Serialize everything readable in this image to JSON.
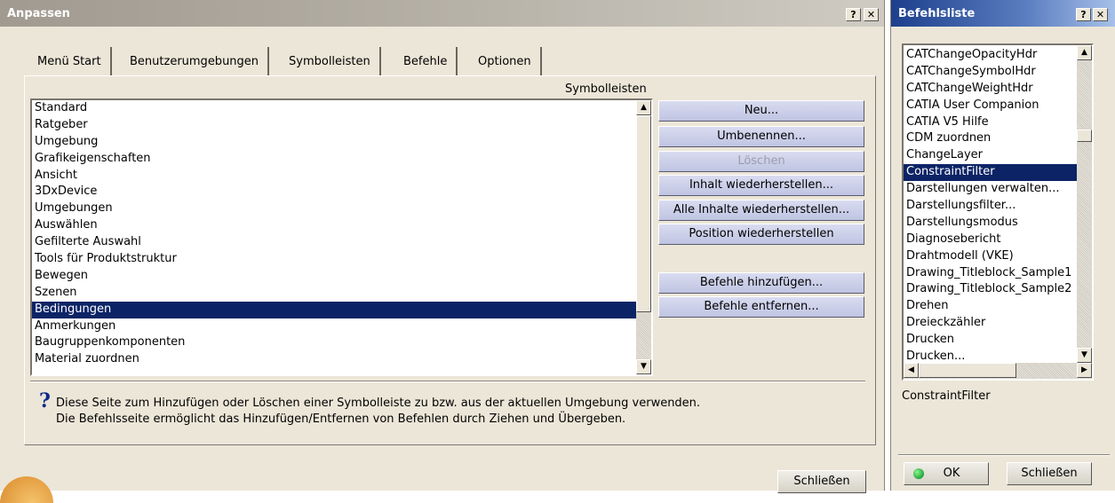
{
  "anpassen": {
    "title": "Anpassen",
    "help_btn": "?",
    "close_btn": "✕",
    "tabs": [
      "Menü Start",
      "Benutzerumgebungen",
      "Symbolleisten",
      "Befehle",
      "Optionen"
    ],
    "list_label": "Symbolleisten",
    "toolbars": [
      "Standard",
      "Ratgeber",
      "Umgebung",
      "Grafikeigenschaften",
      "Ansicht",
      "3DxDevice",
      "Umgebungen",
      "Auswählen",
      "Gefilterte Auswahl",
      "Tools für Produktstruktur",
      "Bewegen",
      "Szenen",
      "Bedingungen",
      "Anmerkungen",
      "Baugruppenkomponenten",
      "Material zuordnen"
    ],
    "selected_toolbar": "Bedingungen",
    "buttons": {
      "new": "Neu...",
      "rename": "Umbenennen...",
      "delete": "Löschen",
      "restore_content": "Inhalt wiederherstellen...",
      "restore_all": "Alle Inhalte wiederherstellen...",
      "restore_position": "Position wiederherstellen",
      "add_commands": "Befehle hinzufügen...",
      "remove_commands": "Befehle entfernen..."
    },
    "help_text_1": "Diese Seite zum Hinzufügen oder Löschen einer Symbolleiste zu bzw. aus der aktuellen Umgebung verwenden.",
    "help_text_2": "Die Befehlsseite ermöglicht das Hinzufügen/Entfernen von Befehlen durch Ziehen und Übergeben.",
    "close_label": "Schließen"
  },
  "befehlsliste": {
    "title": "Befehlsliste",
    "help_btn": "?",
    "close_btn": "✕",
    "commands": [
      "CATChangeOpacityHdr",
      "CATChangeSymbolHdr",
      "CATChangeWeightHdr",
      "CATIA User Companion",
      "CATIA V5 Hilfe",
      "CDM zuordnen",
      "ChangeLayer",
      "ConstraintFilter",
      "Darstellungen verwalten...",
      "Darstellungsfilter...",
      "Darstellungsmodus",
      "Diagnosebericht",
      "Drahtmodell (VKE)",
      "Drawing_Titleblock_Sample1",
      "Drawing_Titleblock_Sample2",
      "Drehen",
      "Dreieckzähler",
      "Drucken",
      "Drucken..."
    ],
    "selected_command": "ConstraintFilter",
    "selection_display": "ConstraintFilter",
    "ok_label": "OK",
    "close_label": "Schließen"
  },
  "colors": {
    "selection": "#0c2466",
    "dialog_bg": "#ece6d8",
    "button_bg": "#c8cce8",
    "ok_indicator": "#1fa83a"
  }
}
